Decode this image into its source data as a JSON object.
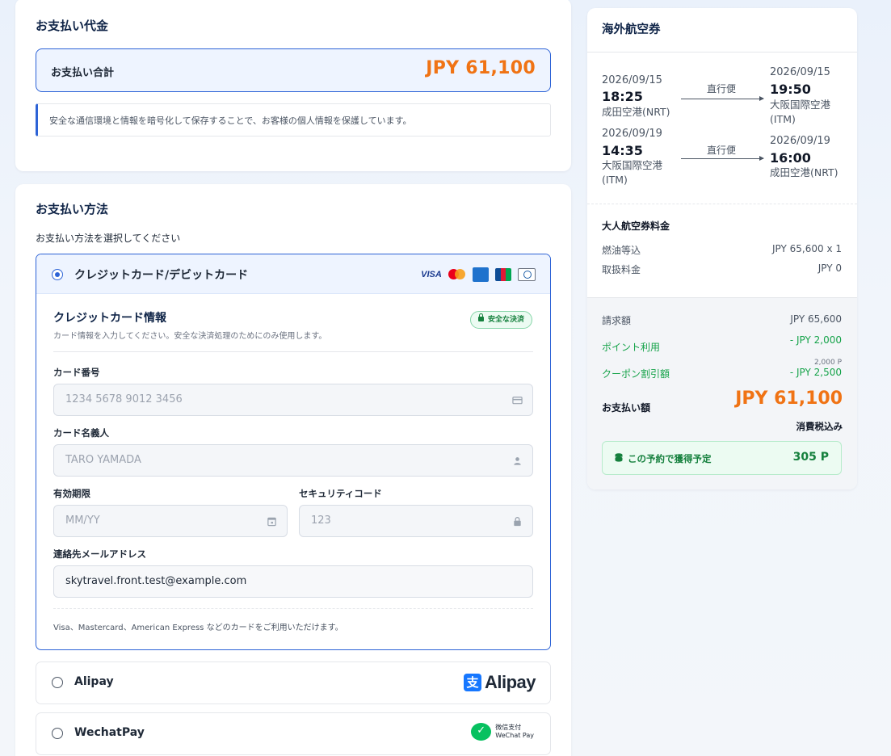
{
  "payment_amount": {
    "title": "お支払い代金",
    "total_label": "お支払い合計",
    "total_value": "JPY 61,100",
    "secure_note": "安全な通信環境と情報を暗号化して保存することで、お客様の個人情報を保護しています。"
  },
  "payment_method": {
    "title": "お支払い方法",
    "instruction": "お支払い方法を選択してください",
    "options": [
      {
        "label": "クレジットカード/デビットカード",
        "selected": true
      },
      {
        "label": "Alipay",
        "selected": false
      },
      {
        "label": "WechatPay",
        "selected": false
      }
    ],
    "card_brands": [
      "VISA",
      "Mastercard",
      "American Express",
      "JCB",
      "Diners Club"
    ],
    "visa_text": "VISA",
    "alipay_logo": {
      "mark": "支",
      "text": "Alipay"
    },
    "wechat_logo": {
      "line1": "微信支付",
      "line2": "WeChat Pay"
    },
    "credit_card": {
      "title": "クレジットカード情報",
      "subtitle": "カード情報を入力してください。安全な決済処理のためにのみ使用します。",
      "secure_badge": "安全な決済",
      "card_number_label": "カード番号",
      "card_number_placeholder": "1234 5678 9012 3456",
      "card_holder_label": "カード名義人",
      "card_holder_placeholder": "TARO YAMADA",
      "expiry_label": "有効期限",
      "expiry_placeholder": "MM/YY",
      "cvc_label": "セキュリティコード",
      "cvc_placeholder": "123",
      "email_label": "連絡先メールアドレス",
      "email_value": "skytravel.front.test@example.com",
      "footnote": "Visa、Mastercard、American Express などのカードをご利用いただけます。"
    }
  },
  "flight": {
    "title": "海外航空券",
    "segments": [
      {
        "dep_date": "2026/09/15",
        "dep_time": "18:25",
        "dep_airport": "成田空港(NRT)",
        "type": "直行便",
        "arr_date": "2026/09/15",
        "arr_time": "19:50",
        "arr_airport": "大阪国際空港(ITM)"
      },
      {
        "dep_date": "2026/09/19",
        "dep_time": "14:35",
        "dep_airport": "大阪国際空港(ITM)",
        "type": "直行便",
        "arr_date": "2026/09/19",
        "arr_time": "16:00",
        "arr_airport": "成田空港(NRT)"
      }
    ],
    "fare": {
      "title": "大人航空券料金",
      "rows": [
        {
          "label": "燃油等込",
          "value": "JPY 65,600 x 1"
        },
        {
          "label": "取扱料金",
          "value": "JPY 0"
        }
      ]
    },
    "billing": {
      "billed_label": "請求額",
      "billed_value": "JPY 65,600",
      "points_label": "ポイント利用",
      "points_value": "- JPY 2,000",
      "points_sub": "2,000 P",
      "coupon_label": "クーポン割引額",
      "coupon_value": "- JPY 2,500",
      "pay_label": "お支払い額",
      "pay_value": "JPY 61,100",
      "tax_note": "消費税込み",
      "earn_label": "この予約で獲得予定",
      "earn_value": "305 P"
    }
  },
  "colors": {
    "primary": "#2d63d6",
    "accent_orange": "#f07314",
    "green": "#16a34a"
  }
}
